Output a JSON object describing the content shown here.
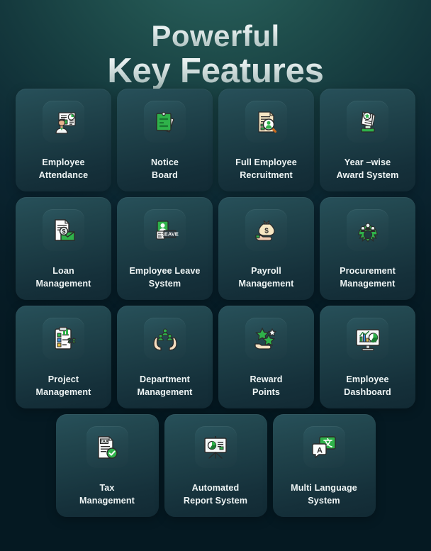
{
  "heading": {
    "line1": "Powerful",
    "line2": "Key Features"
  },
  "theme": {
    "bg_top": "#2b6360",
    "bg_bottom": "#051922",
    "card_bg_top": "#27505a",
    "card_bg_bottom": "#122a34",
    "label_color": "#eff5f5",
    "accent_green": "#2fb24a"
  },
  "rows": [
    {
      "cards": [
        {
          "label": "Employee\nAttendance",
          "icon": "employee-attendance-icon"
        },
        {
          "label": "Notice\nBoard",
          "icon": "notice-board-icon"
        },
        {
          "label": "Full Employee\nRecruitment",
          "icon": "recruitment-icon"
        },
        {
          "label": "Year –wise\nAward System",
          "icon": "award-certificate-icon"
        }
      ]
    },
    {
      "cards": [
        {
          "label": "Loan\nManagement",
          "icon": "loan-document-icon"
        },
        {
          "label": "Employee Leave\nSystem",
          "icon": "leave-badge-icon"
        },
        {
          "label": "Payroll\nManagement",
          "icon": "money-bag-hand-icon"
        },
        {
          "label": "Procurement\nManagement",
          "icon": "procurement-gear-icon"
        }
      ]
    },
    {
      "cards": [
        {
          "label": "Project\nManagement",
          "icon": "project-clipboard-gear-icon"
        },
        {
          "label": "Department\nManagement",
          "icon": "department-hands-people-icon"
        },
        {
          "label": "Reward\nPoints",
          "icon": "reward-stars-hand-icon"
        },
        {
          "label": "Employee\nDashboard",
          "icon": "dashboard-monitor-icon"
        }
      ]
    },
    {
      "cards": [
        {
          "label": "Tax\nManagement",
          "icon": "tax-check-icon"
        },
        {
          "label": "Automated\nReport System",
          "icon": "report-presentation-icon"
        },
        {
          "label": "Multi Language\nSystem",
          "icon": "translate-chat-icon"
        }
      ]
    }
  ]
}
